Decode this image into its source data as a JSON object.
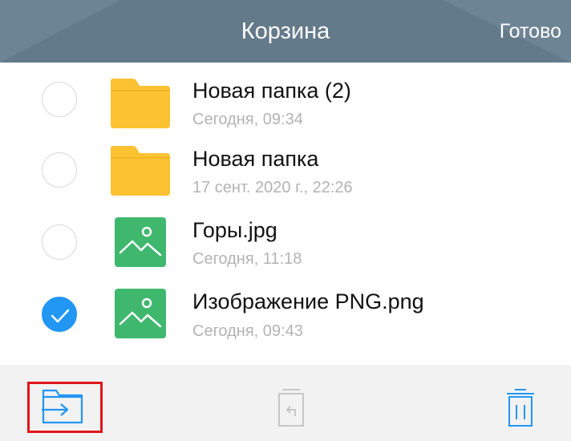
{
  "header": {
    "title": "Корзина",
    "done_label": "Готово"
  },
  "files": [
    {
      "name": "Новая папка (2)",
      "date": "Сегодня, 09:34",
      "type": "folder",
      "selected": false
    },
    {
      "name": "Новая папка",
      "date": "17 сент. 2020 г., 22:26",
      "type": "folder",
      "selected": false
    },
    {
      "name": "Горы.jpg",
      "date": "Сегодня, 11:18",
      "type": "image",
      "selected": false
    },
    {
      "name": "Изображение PNG.png",
      "date": "Сегодня, 09:43",
      "type": "image",
      "selected": true
    }
  ],
  "toolbar": {
    "buttons": [
      {
        "icon": "move-to-folder-icon",
        "enabled": true,
        "highlighted": true
      },
      {
        "icon": "restore-icon",
        "enabled": false
      },
      {
        "icon": "trash-icon",
        "enabled": true
      }
    ]
  },
  "colors": {
    "header_bg": "#637a8a",
    "accent": "#2196f3",
    "folder": "#fcc232",
    "image": "#3fb86e",
    "highlight": "#e0161b"
  }
}
